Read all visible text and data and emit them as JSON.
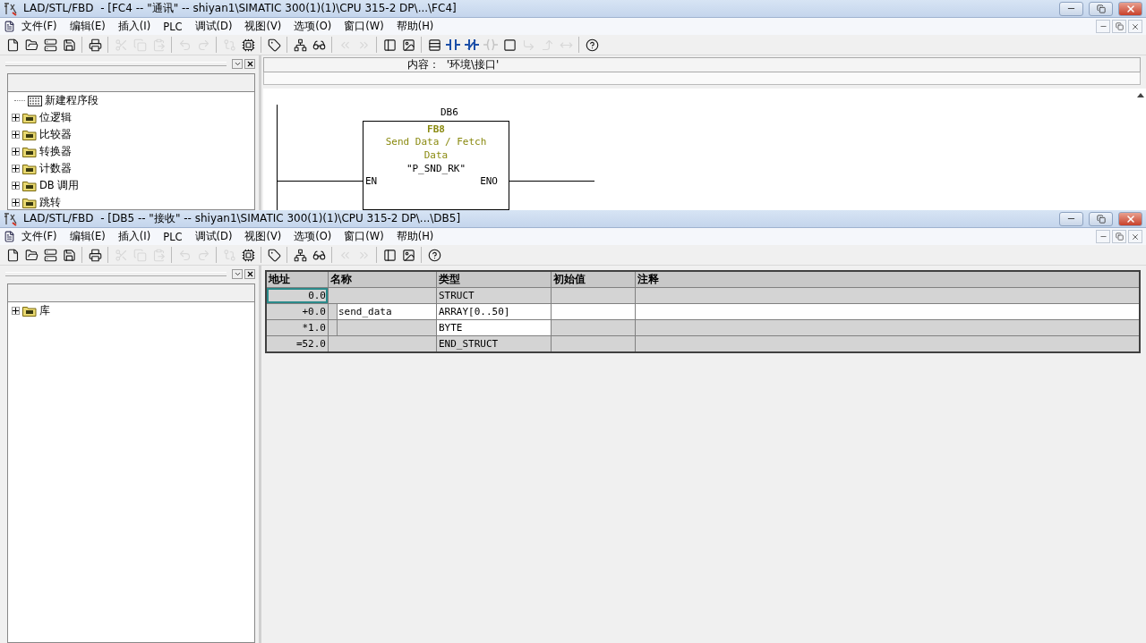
{
  "windows": [
    {
      "title": "LAD/STL/FBD  - [FC4 -- \"通讯\" -- shiyan1\\SIMATIC 300(1)(1)\\CPU 315-2 DP\\...\\FC4]",
      "menu": [
        "文件(F)",
        "编辑(E)",
        "插入(I)",
        "PLC",
        "调试(D)",
        "视图(V)",
        "选项(O)",
        "窗口(W)",
        "帮助(H)"
      ],
      "toolbar": [
        {
          "kind": "new",
          "disabled": false
        },
        {
          "kind": "open",
          "disabled": false
        },
        {
          "kind": "nodes",
          "disabled": false
        },
        {
          "kind": "save",
          "disabled": false
        },
        {
          "kind": "separator"
        },
        {
          "kind": "print",
          "disabled": false
        },
        {
          "kind": "separator"
        },
        {
          "kind": "cut",
          "disabled": true
        },
        {
          "kind": "copy",
          "disabled": true
        },
        {
          "kind": "paste",
          "disabled": true
        },
        {
          "kind": "separator"
        },
        {
          "kind": "undo",
          "disabled": true
        },
        {
          "kind": "redo",
          "disabled": true
        },
        {
          "kind": "separator"
        },
        {
          "kind": "compare",
          "disabled": true
        },
        {
          "kind": "module",
          "disabled": false
        },
        {
          "kind": "separator"
        },
        {
          "kind": "overview",
          "disabled": false
        },
        {
          "kind": "separator"
        },
        {
          "kind": "network",
          "disabled": false
        },
        {
          "kind": "glasses",
          "disabled": false
        },
        {
          "kind": "separator"
        },
        {
          "kind": "first",
          "disabled": true
        },
        {
          "kind": "last",
          "disabled": true
        },
        {
          "kind": "separator"
        },
        {
          "kind": "panel",
          "disabled": false
        },
        {
          "kind": "detail",
          "disabled": false
        },
        {
          "kind": "separator"
        },
        {
          "kind": "rows",
          "disabled": false
        },
        {
          "kind": "contact",
          "disabled": false
        },
        {
          "kind": "negcontact",
          "disabled": false
        },
        {
          "kind": "coil",
          "disabled": true
        },
        {
          "kind": "box",
          "disabled": false
        },
        {
          "kind": "branchopen",
          "disabled": true
        },
        {
          "kind": "branchclose",
          "disabled": true
        },
        {
          "kind": "wire",
          "disabled": true
        },
        {
          "kind": "separator"
        },
        {
          "kind": "help",
          "disabled": false
        }
      ],
      "tree": [
        {
          "label": "新建程序段",
          "kind": "leaf"
        },
        {
          "label": "位逻辑",
          "kind": "folder",
          "expanded": false
        },
        {
          "label": "比较器",
          "kind": "folder",
          "expanded": false
        },
        {
          "label": "转换器",
          "kind": "folder",
          "expanded": false
        },
        {
          "label": "计数器",
          "kind": "folder",
          "expanded": false
        },
        {
          "label": "DB 调用",
          "kind": "folder",
          "expanded": false
        },
        {
          "label": "跳转",
          "kind": "folder",
          "expanded": false
        }
      ],
      "content": {
        "kind": "ladder",
        "path": "内容：  '环境\\接口'",
        "instance": "DB6",
        "block": "FB8",
        "description": "Send Data / Fetch Data",
        "symbol": "\"P_SND_RK\"",
        "input": "EN",
        "output": "ENO"
      }
    },
    {
      "title": "LAD/STL/FBD  - [DB5 -- \"接收\" -- shiyan1\\SIMATIC 300(1)(1)\\CPU 315-2 DP\\...\\DB5]",
      "menu": [
        "文件(F)",
        "编辑(E)",
        "插入(I)",
        "PLC",
        "调试(D)",
        "视图(V)",
        "选项(O)",
        "窗口(W)",
        "帮助(H)"
      ],
      "toolbar": [
        {
          "kind": "new",
          "disabled": false
        },
        {
          "kind": "open",
          "disabled": false
        },
        {
          "kind": "nodes",
          "disabled": false
        },
        {
          "kind": "save",
          "disabled": false
        },
        {
          "kind": "separator"
        },
        {
          "kind": "print",
          "disabled": false
        },
        {
          "kind": "separator"
        },
        {
          "kind": "cut",
          "disabled": true
        },
        {
          "kind": "copy",
          "disabled": true
        },
        {
          "kind": "paste",
          "disabled": true
        },
        {
          "kind": "separator"
        },
        {
          "kind": "undo",
          "disabled": true
        },
        {
          "kind": "redo",
          "disabled": true
        },
        {
          "kind": "separator"
        },
        {
          "kind": "compare",
          "disabled": true
        },
        {
          "kind": "module",
          "disabled": false
        },
        {
          "kind": "separator"
        },
        {
          "kind": "overview",
          "disabled": false
        },
        {
          "kind": "separator"
        },
        {
          "kind": "network",
          "disabled": false
        },
        {
          "kind": "glasses",
          "disabled": false
        },
        {
          "kind": "separator"
        },
        {
          "kind": "first",
          "disabled": true
        },
        {
          "kind": "last",
          "disabled": true
        },
        {
          "kind": "separator"
        },
        {
          "kind": "panel",
          "disabled": false
        },
        {
          "kind": "detail",
          "disabled": false
        },
        {
          "kind": "separator"
        },
        {
          "kind": "help",
          "disabled": false
        }
      ],
      "tree": [
        {
          "label": "库",
          "kind": "folder",
          "expanded": false
        }
      ],
      "content": {
        "kind": "table",
        "columns": [
          "地址",
          "名称",
          "类型",
          "初始值",
          "注释"
        ],
        "rows": [
          {
            "kind": "struct",
            "selected": true,
            "address": "0.0",
            "type": "STRUCT"
          },
          {
            "kind": "element",
            "selected": false,
            "address": "+0.0",
            "name": "send_data",
            "type": "ARRAY[0..50]"
          },
          {
            "kind": "sub",
            "selected": false,
            "address": "*1.0",
            "type": "BYTE"
          },
          {
            "kind": "end",
            "selected": false,
            "address": "=52.0",
            "type": "END_STRUCT"
          }
        ]
      }
    }
  ]
}
